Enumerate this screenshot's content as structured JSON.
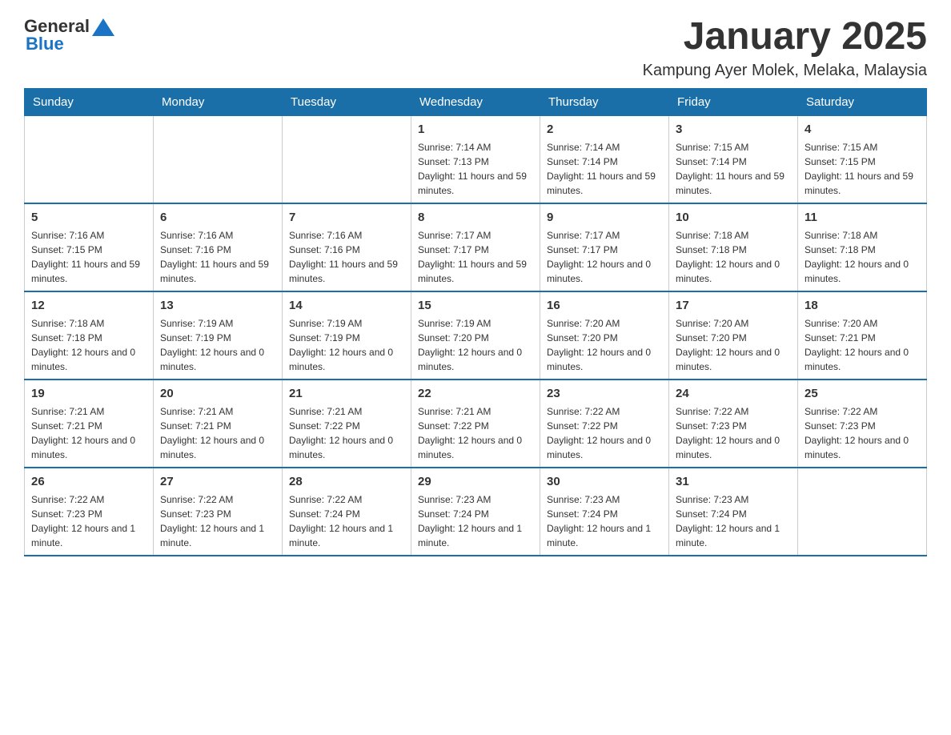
{
  "header": {
    "logo": {
      "general": "General",
      "blue": "Blue"
    },
    "title": "January 2025",
    "subtitle": "Kampung Ayer Molek, Melaka, Malaysia"
  },
  "calendar": {
    "days_of_week": [
      "Sunday",
      "Monday",
      "Tuesday",
      "Wednesday",
      "Thursday",
      "Friday",
      "Saturday"
    ],
    "weeks": [
      [
        {
          "day": "",
          "info": ""
        },
        {
          "day": "",
          "info": ""
        },
        {
          "day": "",
          "info": ""
        },
        {
          "day": "1",
          "info": "Sunrise: 7:14 AM\nSunset: 7:13 PM\nDaylight: 11 hours and 59 minutes."
        },
        {
          "day": "2",
          "info": "Sunrise: 7:14 AM\nSunset: 7:14 PM\nDaylight: 11 hours and 59 minutes."
        },
        {
          "day": "3",
          "info": "Sunrise: 7:15 AM\nSunset: 7:14 PM\nDaylight: 11 hours and 59 minutes."
        },
        {
          "day": "4",
          "info": "Sunrise: 7:15 AM\nSunset: 7:15 PM\nDaylight: 11 hours and 59 minutes."
        }
      ],
      [
        {
          "day": "5",
          "info": "Sunrise: 7:16 AM\nSunset: 7:15 PM\nDaylight: 11 hours and 59 minutes."
        },
        {
          "day": "6",
          "info": "Sunrise: 7:16 AM\nSunset: 7:16 PM\nDaylight: 11 hours and 59 minutes."
        },
        {
          "day": "7",
          "info": "Sunrise: 7:16 AM\nSunset: 7:16 PM\nDaylight: 11 hours and 59 minutes."
        },
        {
          "day": "8",
          "info": "Sunrise: 7:17 AM\nSunset: 7:17 PM\nDaylight: 11 hours and 59 minutes."
        },
        {
          "day": "9",
          "info": "Sunrise: 7:17 AM\nSunset: 7:17 PM\nDaylight: 12 hours and 0 minutes."
        },
        {
          "day": "10",
          "info": "Sunrise: 7:18 AM\nSunset: 7:18 PM\nDaylight: 12 hours and 0 minutes."
        },
        {
          "day": "11",
          "info": "Sunrise: 7:18 AM\nSunset: 7:18 PM\nDaylight: 12 hours and 0 minutes."
        }
      ],
      [
        {
          "day": "12",
          "info": "Sunrise: 7:18 AM\nSunset: 7:18 PM\nDaylight: 12 hours and 0 minutes."
        },
        {
          "day": "13",
          "info": "Sunrise: 7:19 AM\nSunset: 7:19 PM\nDaylight: 12 hours and 0 minutes."
        },
        {
          "day": "14",
          "info": "Sunrise: 7:19 AM\nSunset: 7:19 PM\nDaylight: 12 hours and 0 minutes."
        },
        {
          "day": "15",
          "info": "Sunrise: 7:19 AM\nSunset: 7:20 PM\nDaylight: 12 hours and 0 minutes."
        },
        {
          "day": "16",
          "info": "Sunrise: 7:20 AM\nSunset: 7:20 PM\nDaylight: 12 hours and 0 minutes."
        },
        {
          "day": "17",
          "info": "Sunrise: 7:20 AM\nSunset: 7:20 PM\nDaylight: 12 hours and 0 minutes."
        },
        {
          "day": "18",
          "info": "Sunrise: 7:20 AM\nSunset: 7:21 PM\nDaylight: 12 hours and 0 minutes."
        }
      ],
      [
        {
          "day": "19",
          "info": "Sunrise: 7:21 AM\nSunset: 7:21 PM\nDaylight: 12 hours and 0 minutes."
        },
        {
          "day": "20",
          "info": "Sunrise: 7:21 AM\nSunset: 7:21 PM\nDaylight: 12 hours and 0 minutes."
        },
        {
          "day": "21",
          "info": "Sunrise: 7:21 AM\nSunset: 7:22 PM\nDaylight: 12 hours and 0 minutes."
        },
        {
          "day": "22",
          "info": "Sunrise: 7:21 AM\nSunset: 7:22 PM\nDaylight: 12 hours and 0 minutes."
        },
        {
          "day": "23",
          "info": "Sunrise: 7:22 AM\nSunset: 7:22 PM\nDaylight: 12 hours and 0 minutes."
        },
        {
          "day": "24",
          "info": "Sunrise: 7:22 AM\nSunset: 7:23 PM\nDaylight: 12 hours and 0 minutes."
        },
        {
          "day": "25",
          "info": "Sunrise: 7:22 AM\nSunset: 7:23 PM\nDaylight: 12 hours and 0 minutes."
        }
      ],
      [
        {
          "day": "26",
          "info": "Sunrise: 7:22 AM\nSunset: 7:23 PM\nDaylight: 12 hours and 1 minute."
        },
        {
          "day": "27",
          "info": "Sunrise: 7:22 AM\nSunset: 7:23 PM\nDaylight: 12 hours and 1 minute."
        },
        {
          "day": "28",
          "info": "Sunrise: 7:22 AM\nSunset: 7:24 PM\nDaylight: 12 hours and 1 minute."
        },
        {
          "day": "29",
          "info": "Sunrise: 7:23 AM\nSunset: 7:24 PM\nDaylight: 12 hours and 1 minute."
        },
        {
          "day": "30",
          "info": "Sunrise: 7:23 AM\nSunset: 7:24 PM\nDaylight: 12 hours and 1 minute."
        },
        {
          "day": "31",
          "info": "Sunrise: 7:23 AM\nSunset: 7:24 PM\nDaylight: 12 hours and 1 minute."
        },
        {
          "day": "",
          "info": ""
        }
      ]
    ]
  }
}
